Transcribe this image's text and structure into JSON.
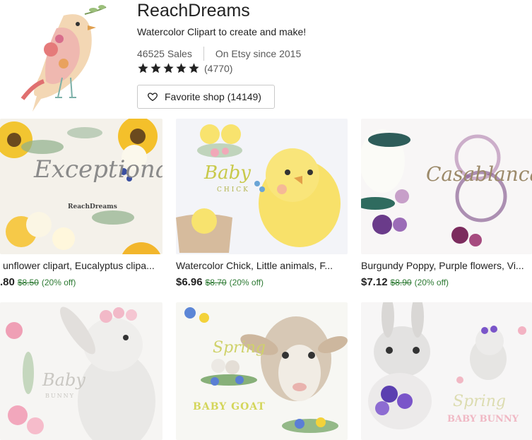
{
  "shop": {
    "name": "ReachDreams",
    "tagline": "Watercolor Clipart to create and make!",
    "sales": "46525 Sales",
    "since": "On Etsy since 2015",
    "rating_count": "(4770)",
    "favorite_label": "Favorite shop (14149)"
  },
  "listings": [
    {
      "title": "unflower clipart, Eucalyptus clipa...",
      "price": ".80",
      "original": "$8.50",
      "discount": "(20% off)",
      "img_text": "Exceptional",
      "brand": "ReachDreams"
    },
    {
      "title": "Watercolor Chick, Little animals, F...",
      "price": "$6.96",
      "original": "$8.70",
      "discount": "(20% off)",
      "img_text": "Baby",
      "img_sub": "CHICK"
    },
    {
      "title": "Burgundy Poppy, Purple flowers, Vi...",
      "price": "$7.12",
      "original": "$8.90",
      "discount": "(20% off)",
      "img_text": "Casablanca"
    },
    {
      "img_text": "Baby",
      "img_sub": "BUNNY"
    },
    {
      "img_text": "Spring",
      "img_sub": "BABY GOAT"
    },
    {
      "img_text": "Spring",
      "img_sub": "BABY BUNNY"
    }
  ],
  "colors": {
    "accent_green": "#2d7a33",
    "text": "#222222",
    "muted": "#595959"
  }
}
